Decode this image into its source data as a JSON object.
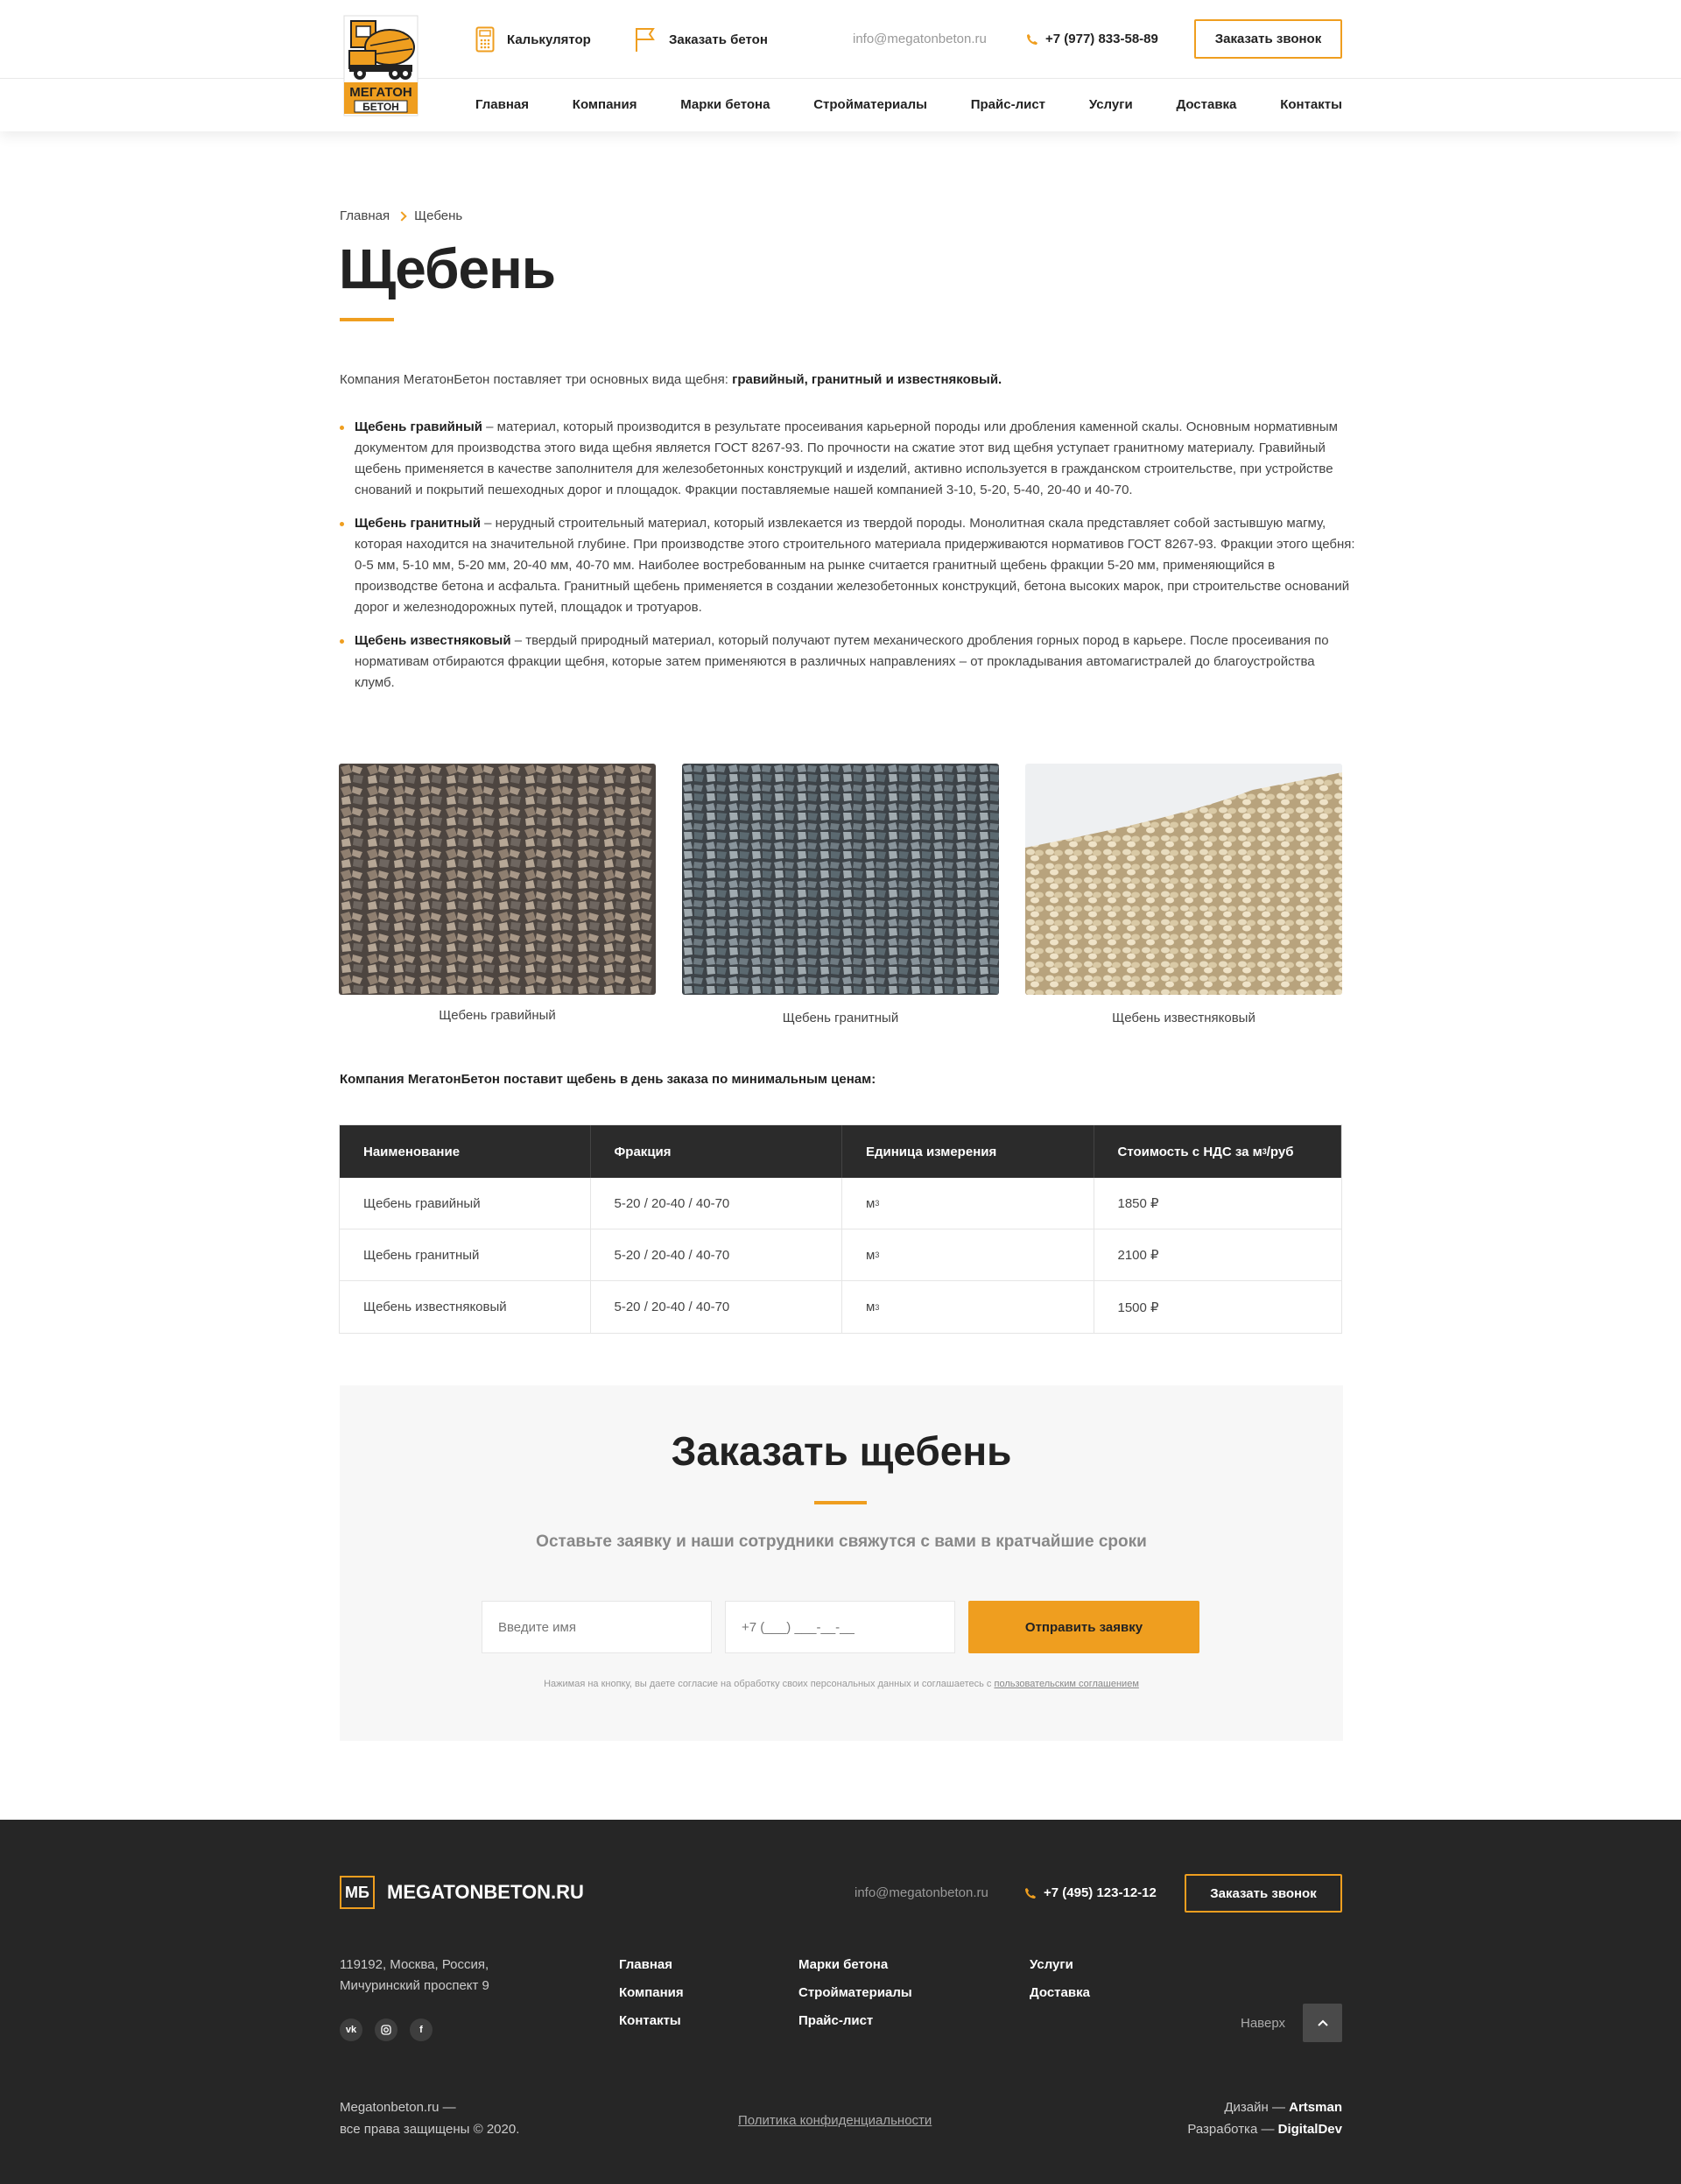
{
  "header": {
    "logo_text_1": "МЕГАТОН",
    "logo_text_2": "БЕТОН",
    "calculator": "Калькулятор",
    "order_concrete": "Заказать бетон",
    "email": "info@megatonbeton.ru",
    "phone": "+7 (977) 833-58-89",
    "call_button": "Заказать звонок",
    "nav": [
      "Главная",
      "Компания",
      "Марки бетона",
      "Стройматериалы",
      "Прайс-лист",
      "Услуги",
      "Доставка",
      "Контакты"
    ]
  },
  "breadcrumb": {
    "home": "Главная",
    "current": "Щебень"
  },
  "page_title": "Щебень",
  "intro": {
    "text": "Компания МегатонБетон поставляет три основных вида щебня: ",
    "bold": "гравийный, гранитный и известняковый."
  },
  "types": [
    {
      "name": "Щебень гравийный",
      "text": " – материал, который производится в результате просеивания карьерной породы или дробления каменной скалы. Основным нормативным документом для производства этого вида щебня является ГОСТ 8267-93. По прочности на сжатие этот вид щебня уступает гранитному материалу. Гравийный щебень применяется в качестве заполнителя для железобетонных конструкций и изделий, активно используется в гражданском строительстве, при устройстве снований и покрытий пешеходных дорог и площадок. Фракции поставляемые нашей компанией 3-10, 5-20, 5-40, 20-40 и 40-70."
    },
    {
      "name": "Щебень гранитный",
      "text": " – нерудный строительный материал, который извлекается из твердой породы. Монолитная скала представляет собой застывшую магму, которая находится на значительной глубине. При производстве этого строительного материала придерживаются нормативов ГОСТ 8267-93. Фракции этого щебня: 0-5 мм, 5-10 мм, 5-20 мм, 20-40 мм, 40-70 мм. Наиболее востребованным на рынке считается гранитный щебень фракции 5-20 мм, применяющийся в производстве бетона и асфальта. Гранитный щебень применяется в создании железобетонных конструкций, бетона высоких марок, при строительстве оснований дорог и железнодорожных путей, площадок и тротуаров."
    },
    {
      "name": "Щебень известняковый",
      "text": " – твердый природный материал, который получают путем механического дробления горных пород в карьере. После просеивания по нормативам отбираются фракции щебня, которые затем применяются в различных направлениях – от прокладывания автомагистралей до благоустройства клумб."
    }
  ],
  "gallery": [
    "Щебень гравийный",
    "Щебень гранитный",
    "Щебень известняковый"
  ],
  "price_lead": "Компания МегатонБетон поставит щебень в день заказа по минимальным ценам:",
  "table": {
    "headers": [
      "Наименование",
      "Фракция",
      "Единица измерения",
      "Стоимость с НДС за м",
      "3",
      "/руб"
    ],
    "rows": [
      {
        "name": "Щебень гравийный",
        "fraction": "5-20 / 20-40 / 40-70",
        "unit": "м",
        "unit_sup": "3",
        "price": "1850 ₽"
      },
      {
        "name": "Щебень гранитный",
        "fraction": "5-20 / 20-40 / 40-70",
        "unit": "м",
        "unit_sup": "3",
        "price": "2100 ₽"
      },
      {
        "name": "Щебень известняковый",
        "fraction": "5-20 / 20-40 / 40-70",
        "unit": "м",
        "unit_sup": "3",
        "price": "1500 ₽"
      }
    ]
  },
  "order_form": {
    "title": "Заказать щебень",
    "subtitle": "Оставьте заявку и наши сотрудники свяжутся с вами в кратчайшие сроки",
    "name_placeholder": "Введите имя",
    "phone_placeholder": "+7 (___) ___-__-__",
    "submit": "Отправить заявку",
    "agree_text": "Нажимая на кнопку, вы даете согласие на обработку своих персональных данных и соглашаетесь с ",
    "agree_link": "пользовательским соглашением"
  },
  "footer": {
    "logo_box": "МБ",
    "logo_name": "MEGATONBETON.RU",
    "email": "info@megatonbeton.ru",
    "phone": "+7 (495) 123-12-12",
    "call_button": "Заказать звонок",
    "address_1": "119192, Москва, Россия,",
    "address_2": "Мичуринский проспект 9",
    "social": [
      "vk",
      "ig",
      "f"
    ],
    "col1": [
      "Главная",
      "Компания",
      "Контакты"
    ],
    "col2": [
      "Марки бетона",
      "Стройматериалы",
      "Прайс-лист"
    ],
    "col3": [
      "Услуги",
      "Доставка"
    ],
    "up_label": "Наверх",
    "copy_1": "Megatonbeton.ru —",
    "copy_2": "все права защищены © 2020.",
    "privacy": "Политика конфиденциальности",
    "design_label": "Дизайн — ",
    "design_name": "Artsman",
    "dev_label": "Разработка — ",
    "dev_name": "DigitalDev"
  },
  "colors": {
    "accent": "#ef9e1f",
    "dark": "#262626",
    "table_head": "#2b2b2b"
  }
}
